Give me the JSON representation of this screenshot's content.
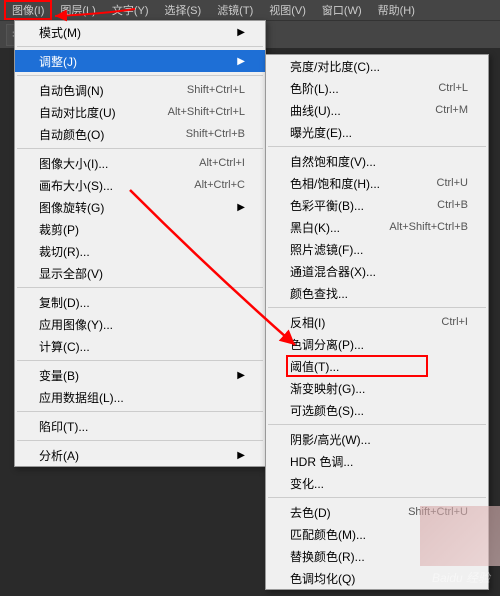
{
  "menubar": {
    "items": [
      {
        "label": "图像(I)"
      },
      {
        "label": "图层(L)"
      },
      {
        "label": "文字(Y)"
      },
      {
        "label": "选择(S)"
      },
      {
        "label": "滤镜(T)"
      },
      {
        "label": "视图(V)"
      },
      {
        "label": "窗口(W)"
      },
      {
        "label": "帮助(H)"
      }
    ]
  },
  "menu1": {
    "groups": [
      [
        {
          "label": "模式(M)",
          "arrow": "▶"
        }
      ],
      [
        {
          "label": "调整(J)",
          "arrow": "▶",
          "sel": true
        }
      ],
      [
        {
          "label": "自动色调(N)",
          "shortcut": "Shift+Ctrl+L"
        },
        {
          "label": "自动对比度(U)",
          "shortcut": "Alt+Shift+Ctrl+L"
        },
        {
          "label": "自动颜色(O)",
          "shortcut": "Shift+Ctrl+B"
        }
      ],
      [
        {
          "label": "图像大小(I)...",
          "shortcut": "Alt+Ctrl+I"
        },
        {
          "label": "画布大小(S)...",
          "shortcut": "Alt+Ctrl+C"
        },
        {
          "label": "图像旋转(G)",
          "arrow": "▶"
        },
        {
          "label": "裁剪(P)"
        },
        {
          "label": "裁切(R)..."
        },
        {
          "label": "显示全部(V)"
        }
      ],
      [
        {
          "label": "复制(D)..."
        },
        {
          "label": "应用图像(Y)..."
        },
        {
          "label": "计算(C)..."
        }
      ],
      [
        {
          "label": "变量(B)",
          "arrow": "▶"
        },
        {
          "label": "应用数据组(L)..."
        }
      ],
      [
        {
          "label": "陷印(T)..."
        }
      ],
      [
        {
          "label": "分析(A)",
          "arrow": "▶"
        }
      ]
    ]
  },
  "menu2": {
    "groups": [
      [
        {
          "label": "亮度/对比度(C)..."
        },
        {
          "label": "色阶(L)...",
          "shortcut": "Ctrl+L"
        },
        {
          "label": "曲线(U)...",
          "shortcut": "Ctrl+M"
        },
        {
          "label": "曝光度(E)..."
        }
      ],
      [
        {
          "label": "自然饱和度(V)..."
        },
        {
          "label": "色相/饱和度(H)...",
          "shortcut": "Ctrl+U"
        },
        {
          "label": "色彩平衡(B)...",
          "shortcut": "Ctrl+B"
        },
        {
          "label": "黑白(K)...",
          "shortcut": "Alt+Shift+Ctrl+B"
        },
        {
          "label": "照片滤镜(F)..."
        },
        {
          "label": "通道混合器(X)..."
        },
        {
          "label": "颜色查找..."
        }
      ],
      [
        {
          "label": "反相(I)",
          "shortcut": "Ctrl+I"
        },
        {
          "label": "色调分离(P)..."
        },
        {
          "label": "阈值(T)...",
          "hl": true
        },
        {
          "label": "渐变映射(G)..."
        },
        {
          "label": "可选颜色(S)..."
        }
      ],
      [
        {
          "label": "阴影/高光(W)..."
        },
        {
          "label": "HDR 色调..."
        },
        {
          "label": "变化..."
        }
      ],
      [
        {
          "label": "去色(D)",
          "shortcut": "Shift+Ctrl+U"
        },
        {
          "label": "匹配颜色(M)..."
        },
        {
          "label": "替换颜色(R)..."
        },
        {
          "label": "色调均化(Q)"
        }
      ]
    ]
  },
  "watermark": "Baidu 经验"
}
